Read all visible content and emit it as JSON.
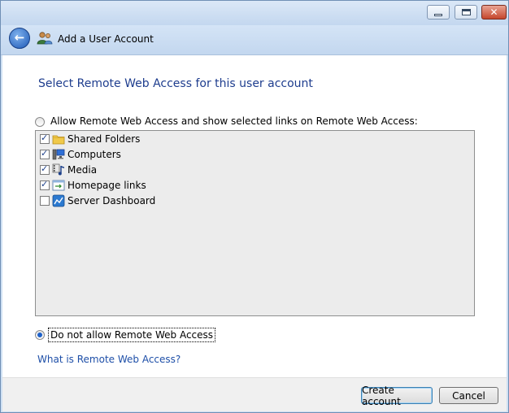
{
  "wizard": {
    "title": "Add a User Account"
  },
  "main": {
    "heading": "Select Remote Web Access for this user account",
    "option_allow_label": "Allow Remote Web Access and show selected links on Remote Web Access:",
    "option_allow_selected": false,
    "links": [
      {
        "label": "Shared Folders",
        "checked": true,
        "icon": "folder-icon"
      },
      {
        "label": "Computers",
        "checked": true,
        "icon": "computers-icon"
      },
      {
        "label": "Media",
        "checked": true,
        "icon": "media-icon"
      },
      {
        "label": "Homepage links",
        "checked": true,
        "icon": "homepage-links-icon"
      },
      {
        "label": "Server Dashboard",
        "checked": false,
        "icon": "server-dashboard-icon"
      }
    ],
    "option_deny_label": "Do not allow Remote Web Access",
    "option_deny_selected": true,
    "help_link": "What is Remote Web Access?"
  },
  "footer": {
    "create_label": "Create account",
    "cancel_label": "Cancel"
  },
  "colors": {
    "heading": "#1e3d8e",
    "link": "#1e4fa8",
    "accent": "#1f62c9"
  }
}
